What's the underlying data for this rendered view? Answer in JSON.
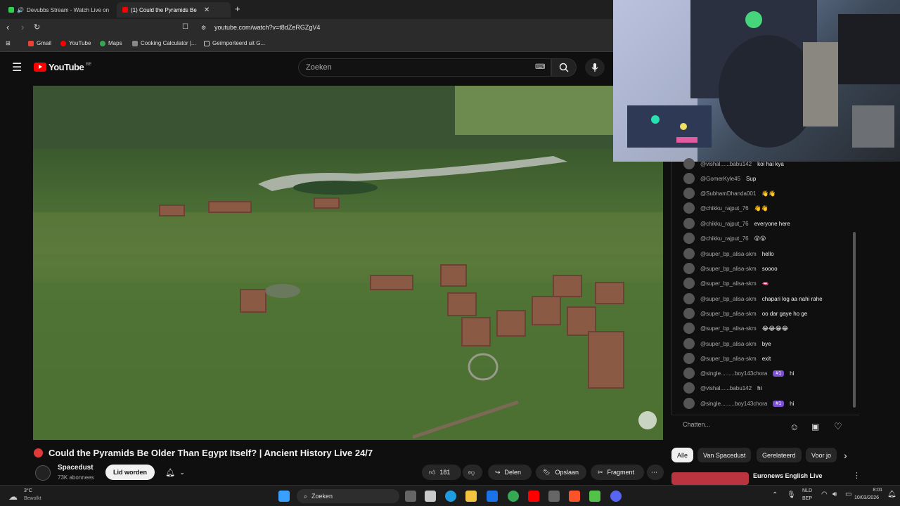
{
  "browser": {
    "tabs": [
      {
        "label": "Devubbs Stream - Watch Live on"
      },
      {
        "label": "(1)  Could the Pyramids Be"
      }
    ],
    "new_tab": "+",
    "url": "youtube.com/watch?v=t8dZeRGZgV4",
    "bookmarks": [
      "Gmail",
      "YouTube",
      "Maps",
      "Cooking Calculator |...",
      "Geïmporteerd uit G..."
    ]
  },
  "youtube": {
    "logo_text": "YouTube",
    "region": "BE",
    "search_placeholder": "Zoeken"
  },
  "video": {
    "title": "Could the Pyramids Be Older Than Egypt Itself? | Ancient History Live 24/7",
    "channel": "Spacedust",
    "subscribers": "73K abonnees",
    "join_label": "Lid worden",
    "likes": "181",
    "share_label": "Delen",
    "save_label": "Opslaan",
    "clip_label": "Fragment"
  },
  "chat": {
    "messages": [
      {
        "user": "@vishal......babu142",
        "msg": "koi hai kya",
        "badge": ""
      },
      {
        "user": "@GomerKyle45",
        "msg": "Sup",
        "badge": ""
      },
      {
        "user": "@SubhamDhanda001",
        "msg": "👋👋",
        "badge": ""
      },
      {
        "user": "@chikku_rajput_76",
        "msg": "👋👋",
        "badge": ""
      },
      {
        "user": "@chikku_rajput_76",
        "msg": "everyone here",
        "badge": ""
      },
      {
        "user": "@chikku_rajput_76",
        "msg": "😮😮",
        "badge": ""
      },
      {
        "user": "@super_bp_alisa-skm",
        "msg": "hello",
        "badge": ""
      },
      {
        "user": "@super_bp_alisa-skm",
        "msg": "soooo",
        "badge": ""
      },
      {
        "user": "@super_bp_alisa-skm",
        "msg": "🫦",
        "badge": ""
      },
      {
        "user": "@super_bp_alisa-skm",
        "msg": "chapari log aa nahi rahe",
        "badge": ""
      },
      {
        "user": "@super_bp_alisa-skm",
        "msg": "oo dar gaye ho ge",
        "badge": ""
      },
      {
        "user": "@super_bp_alisa-skm",
        "msg": "😂😂😂😂",
        "badge": ""
      },
      {
        "user": "@super_bp_alisa-skm",
        "msg": "bye",
        "badge": ""
      },
      {
        "user": "@super_bp_alisa-skm",
        "msg": "exit",
        "badge": ""
      },
      {
        "user": "@single.........boy143chora",
        "msg": "hi",
        "badge": "#1"
      },
      {
        "user": "@vishal......babu142",
        "msg": "hi",
        "badge": ""
      },
      {
        "user": "@single.........boy143chora",
        "msg": "hi",
        "badge": "#1"
      }
    ],
    "input_placeholder": "Chatten..."
  },
  "chips": [
    "Alle",
    "Van Spacedust",
    "Gerelateerd",
    "Voor jo"
  ],
  "next_video_title": "Euronews English Live",
  "taskbar": {
    "weather_temp": "3°C",
    "weather_desc": "Bewolkt",
    "search_label": "Zoeken",
    "lang": "NLD",
    "lang2": "BEP",
    "time": "8:01",
    "date": "10/03/2026"
  },
  "colors": {
    "background": "#0f0f0f",
    "accent_red": "#ff0000",
    "live_dot": "#e03a3a",
    "badge": "#7b4fd1"
  }
}
